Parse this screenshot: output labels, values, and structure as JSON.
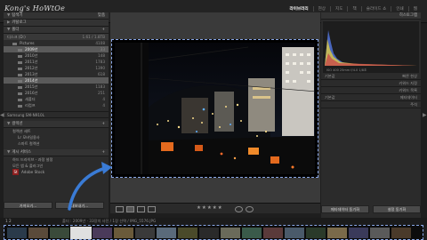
{
  "app": {
    "brand": "Kong's HoWtOe"
  },
  "modules": [
    "라이브러리",
    "현상",
    "지도",
    "책",
    "슬라이드 쇼",
    "인쇄",
    "웹"
  ],
  "left": {
    "navigator_label": "탐색기",
    "fit_label": "맞춤",
    "catalog_label": "카탈로그",
    "folders_label": "폴더",
    "volume": {
      "name": "디스크 (D:)",
      "size": "1.61 / 1.8TB"
    },
    "folders": [
      {
        "name": "Pictures",
        "count": "4108",
        "level": 1,
        "selected": false
      },
      {
        "name": "2009년",
        "count": "33",
        "level": 2,
        "selected": true
      },
      {
        "name": "2010년",
        "count": "148",
        "level": 2,
        "selected": false
      },
      {
        "name": "2011년",
        "count": "1783",
        "level": 2,
        "selected": false
      },
      {
        "name": "2012년",
        "count": "1390",
        "level": 2,
        "selected": false
      },
      {
        "name": "2013년",
        "count": "618",
        "level": 2,
        "selected": false
      },
      {
        "name": "2014년",
        "count": "",
        "level": 2,
        "selected": true
      },
      {
        "name": "2015년",
        "count": "1183",
        "level": 2,
        "selected": false
      },
      {
        "name": "2016년",
        "count": "251",
        "level": 2,
        "selected": false
      },
      {
        "name": "새폴더",
        "count": "4",
        "level": 2,
        "selected": false
      },
      {
        "name": "리컴프",
        "count": "4",
        "level": 2,
        "selected": false
      }
    ],
    "volume2": "Samsung SM-N910L",
    "collections_label": "컬렉션",
    "collections": [
      "컬렉션 세트",
      "Lr 모바일용사",
      "스마트 컬렉션"
    ],
    "publish_label": "게시 서비스",
    "publish_items": [
      "하드 드라이브 - 과정 설정",
      "모든 앱 & 플러그인"
    ],
    "adobe_stock": "Adobe Stock",
    "import_btn": "가져오기...",
    "export_btn": "내보내기..."
  },
  "right": {
    "histogram_label": "히스토그램",
    "histo_info": "ISO 400  25mm  f/4.0  1/8초",
    "quick_develop": "빠른 현상",
    "keywording": "키워드 지정",
    "keyword_list": "키워드 목록",
    "metadata": "메타데이터",
    "comments": "주석",
    "preset_label": "기본값",
    "sync_meta_btn": "메타데이터 동기화",
    "sync_settings_btn": "설정 동기화"
  },
  "toolbar": {
    "stars": "★★★★★"
  },
  "filmstrip": {
    "pages": "1 2",
    "path": "폴더 : 2009년 · 33장의 사진 / 1장 선택 / IMG_5576.JPG"
  },
  "colors": {
    "selection_dash": "#8aa8e8",
    "accent_arrow": "#3a7bd5",
    "lr_red": "#8b1d1d"
  }
}
